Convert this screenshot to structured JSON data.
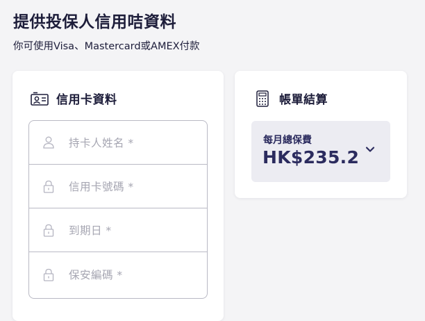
{
  "header": {
    "title": "提供投保人信用咭資料",
    "subtitle": "你可使用Visa、Mastercard或AMEX付款"
  },
  "card_section": {
    "title": "信用卡資料",
    "icon": "id-card-icon",
    "fields": [
      {
        "name": "cardholder-name-field",
        "icon": "user-icon",
        "placeholder": "持卡人姓名 *"
      },
      {
        "name": "card-number-field",
        "icon": "lock-icon",
        "placeholder": "信用卡號碼 *"
      },
      {
        "name": "expiry-date-field",
        "icon": "lock-icon",
        "placeholder": "到期日 *"
      },
      {
        "name": "security-code-field",
        "icon": "lock-icon",
        "placeholder": "保安編碼 *"
      }
    ]
  },
  "billing_section": {
    "title": "帳單結算",
    "icon": "calculator-icon",
    "premium_label": "每月總保費",
    "premium_amount": "HK$235.2",
    "toggle_icon": "chevron-down-icon"
  },
  "colors": {
    "background": "#f4f4f6",
    "card": "#ffffff",
    "text_primary": "#1d1d3a",
    "accent": "#2b2b5e",
    "placeholder": "#a6a6b2",
    "border": "#b9b9c4",
    "summary_box": "#ececf2"
  }
}
